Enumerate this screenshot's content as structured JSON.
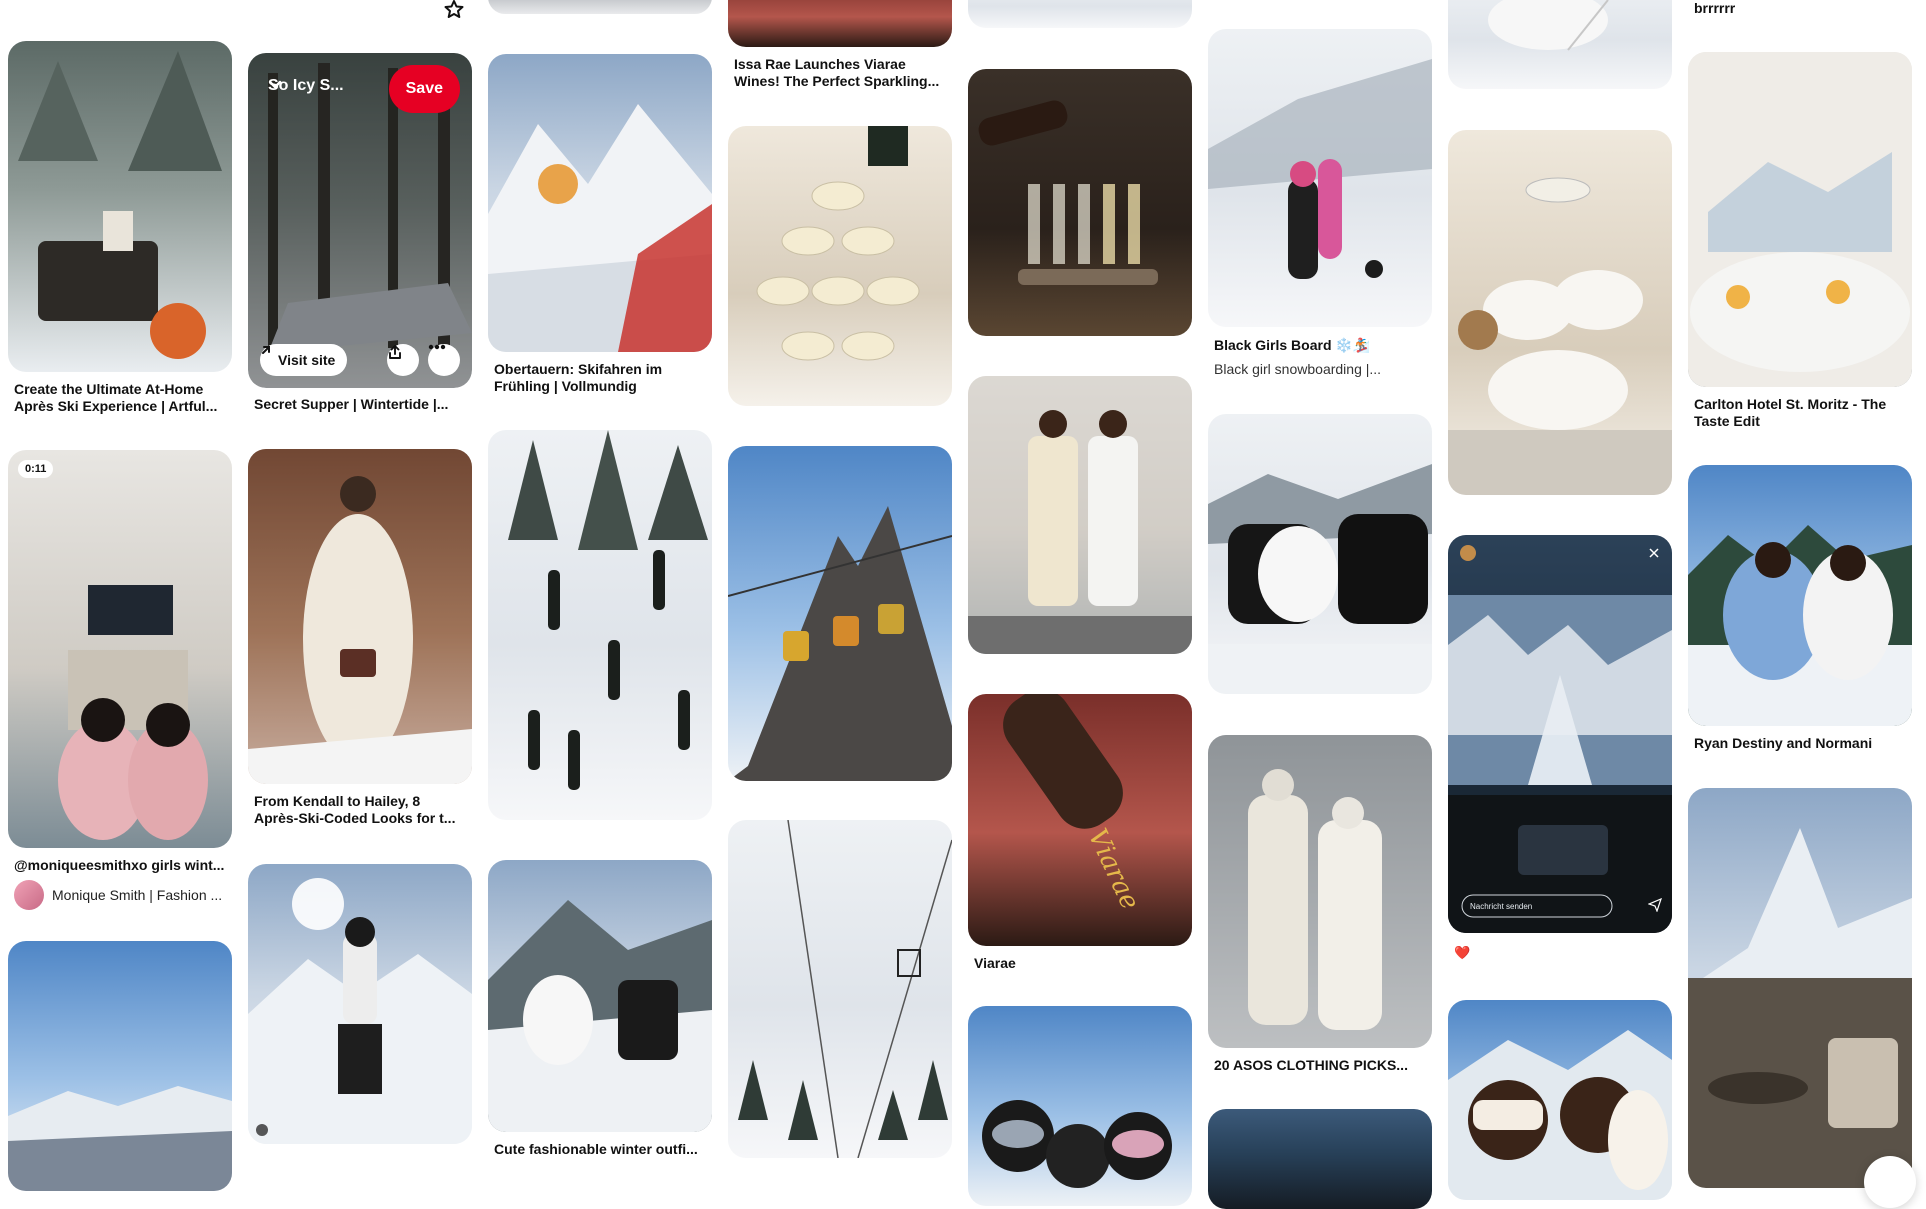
{
  "pins": {
    "c1p1": {
      "title": "Create the Ultimate At-Home Après Ski Experience | Artful..."
    },
    "c1p2": {
      "duration": "0:11",
      "title": "@moniqueesmithxo girls wint...",
      "creator": "Monique Smith | Fashion ..."
    },
    "c2p1": {
      "board": "So Icy S...",
      "save": "Save",
      "visit": "Visit site",
      "title": "Secret Supper | Wintertide |..."
    },
    "c2p2": {
      "title": "From Kendall to Hailey, 8 Après-Ski-Coded Looks for t..."
    },
    "c3p1": {
      "title": "Obertauern: Skifahren im Frühling | Vollmundig"
    },
    "c3p2": {
      "title": "Cute fashionable winter outfi..."
    },
    "c4p0": {
      "title": "Issa Rae Launches Viarae Wines! The Perfect Sparkling..."
    },
    "c5p3": {
      "title": "Viarae"
    },
    "c6p1": {
      "title": "Black Girls Board ❄️🏂",
      "subtitle": "Black girl snowboarding |..."
    },
    "c6p3": {
      "title": "20 ASOS CLOTHING PICKS..."
    },
    "c7p2": {
      "caption": "❤️"
    },
    "c8p0": {
      "title": "brrrrrr"
    },
    "c8p1": {
      "title": "Carlton Hotel St. Moritz - The Taste Edit"
    },
    "c8p2": {
      "title": "Ryan Destiny and Normani"
    }
  },
  "story": {
    "message_placeholder": "Nachricht senden"
  }
}
